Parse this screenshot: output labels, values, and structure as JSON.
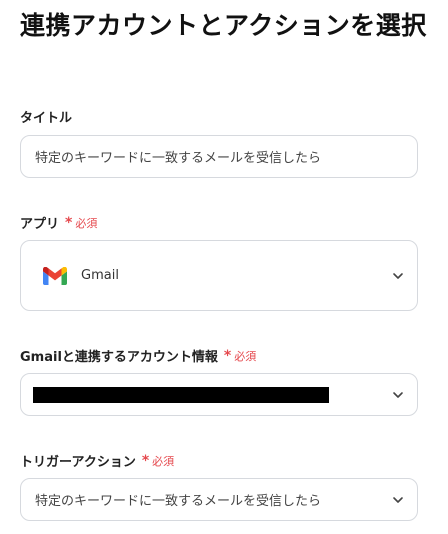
{
  "page_title": "連携アカウントとアクションを選択",
  "required_text": "必須",
  "fields": {
    "title": {
      "label": "タイトル",
      "value": "特定のキーワードに一致するメールを受信したら"
    },
    "app": {
      "label": "アプリ",
      "value": "Gmail",
      "icon": "gmail-icon"
    },
    "account": {
      "label": "Gmailと連携するアカウント情報",
      "value": ""
    },
    "trigger_action": {
      "label": "トリガーアクション",
      "value": "特定のキーワードに一致するメールを受信したら"
    }
  },
  "colors": {
    "required": "#e5484d",
    "border": "#d6d9de"
  }
}
